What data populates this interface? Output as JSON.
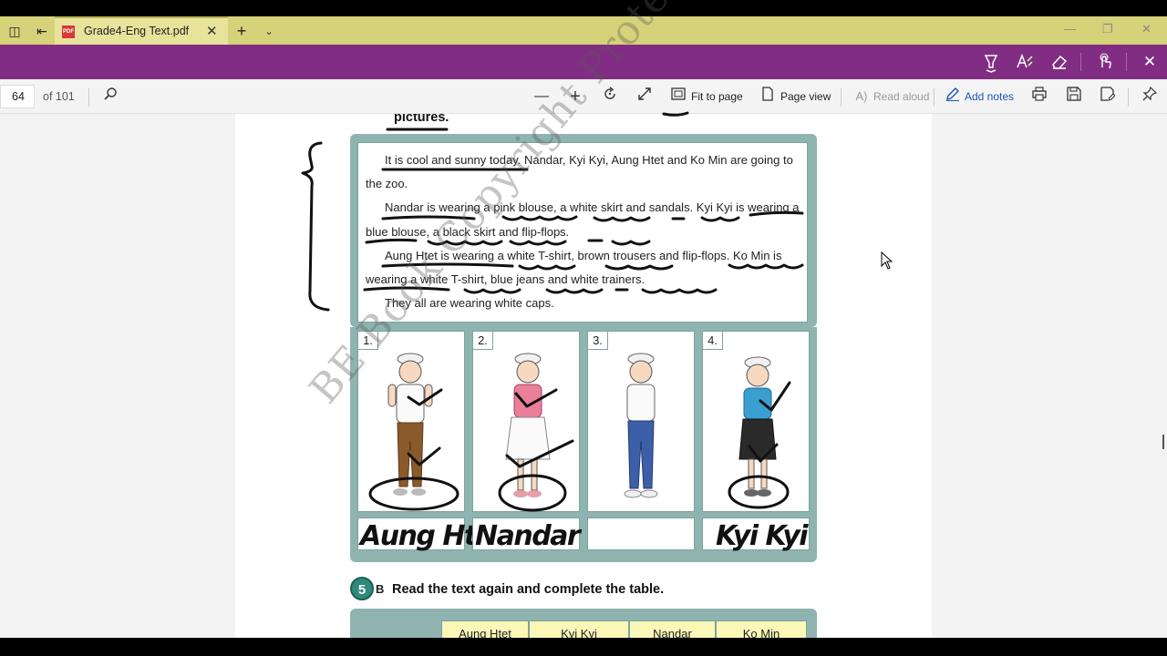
{
  "tab": {
    "title": "Grade4-Eng Text.pdf"
  },
  "toolbar": {
    "page_current": "64",
    "page_total": "of 101",
    "fit_to_page": "Fit to page",
    "page_view": "Page view",
    "read_aloud": "Read aloud",
    "add_notes": "Add notes"
  },
  "document": {
    "heading_fragment": "pictures.",
    "passage": [
      "It is cool and sunny today. Nandar, Kyi Kyi, Aung Htet and Ko Min are going to the zoo.",
      "Nandar is wearing a pink blouse, a white skirt and sandals. Kyi Kyi is wearing a blue blouse, a black skirt and flip-flops.",
      "Aung Htet is wearing a white T-shirt, brown trousers and flip-flops. Ko Min is wearing a white T-shirt, blue jeans and white trainers.",
      "They all are wearing white caps."
    ],
    "panels": [
      "1.",
      "2.",
      "3.",
      "4."
    ],
    "handwritten_names": [
      "Aung Htet",
      "Nandar",
      "",
      "Kyi Kyi"
    ],
    "section_number": "5",
    "section_letter": "B",
    "section_task": "Read the text again and complete the table.",
    "table_headers": [
      "Aung Htet",
      "Kyi Kyi",
      "Nandar",
      "Ko Min"
    ],
    "watermark": "BE Book Copyright Protected"
  },
  "icons": {
    "tab_actions": "tab-actions-icon",
    "set_aside": "set-aside-tabs-icon",
    "pdf": "pdf-file-icon",
    "highlight": "highlighter-icon",
    "text_pen": "text-pen-icon",
    "eraser": "eraser-icon",
    "touch_write": "touch-write-icon",
    "close": "close-icon",
    "search": "search-icon",
    "zoom_out": "zoom-out-icon",
    "zoom_in": "zoom-in-icon",
    "rotate": "rotate-icon",
    "full_screen": "full-screen-icon",
    "print": "print-icon",
    "save": "save-icon",
    "save_as": "save-as-icon",
    "pin": "pin-icon"
  }
}
